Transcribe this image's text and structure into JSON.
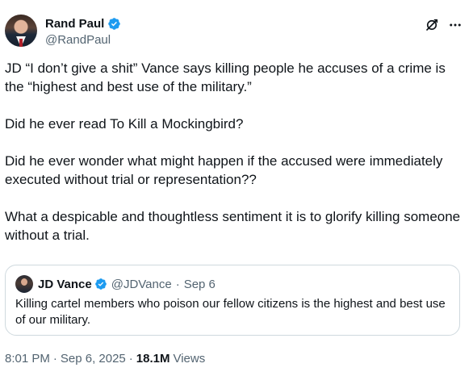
{
  "author": {
    "display_name": "Rand Paul",
    "handle": "@RandPaul",
    "verified": true
  },
  "header_icons": [
    "grok-icon",
    "more-icon"
  ],
  "tweet": {
    "text": "JD “I don’t give a shit” Vance says killing people he accuses of a crime is the “highest and best use of the military.”\n\nDid he ever read To Kill a Mockingbird?\n\nDid he ever wonder what might happen if the accused were immediately executed without trial or representation??\n\nWhat a despicable and thoughtless sentiment it is to glorify killing someone without a trial."
  },
  "quote": {
    "display_name": "JD Vance",
    "handle": "@JDVance",
    "separator": "·",
    "date": "Sep 6",
    "text": "Killing cartel members who poison our fellow citizens is the highest and best use of our military."
  },
  "meta": {
    "time": "8:01 PM",
    "separator": "·",
    "date": "Sep 6, 2025",
    "separator2": "·",
    "views_count": "18.1M",
    "views_label": "Views"
  },
  "colors": {
    "text": "#0f1419",
    "secondary": "#536471",
    "border": "#cfd9de",
    "verified": "#1d9bf0"
  }
}
